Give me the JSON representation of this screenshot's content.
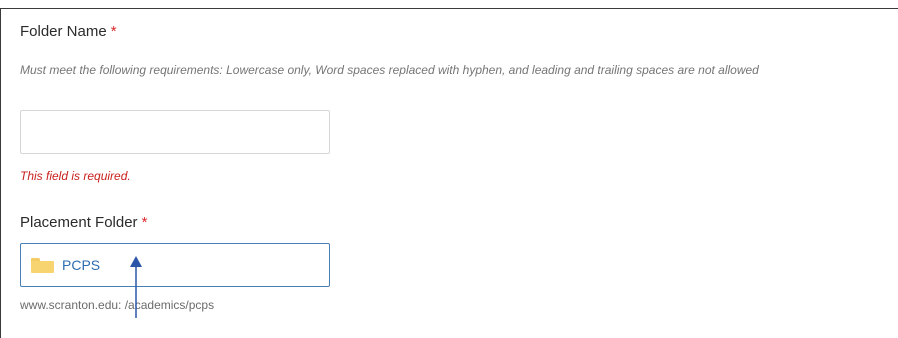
{
  "folder_name": {
    "label": "Folder Name",
    "required_marker": "*",
    "help": "Must meet the following requirements: Lowercase only, Word spaces replaced with hyphen, and leading and trailing spaces are not allowed",
    "value": "",
    "error": "This field is required."
  },
  "placement_folder": {
    "label": "Placement Folder",
    "required_marker": "*",
    "icon": "folder-icon",
    "value": "PCPS",
    "path": "www.scranton.edu: /academics/pcps"
  },
  "colors": {
    "required": "#d9282b",
    "error": "#c9211e",
    "link": "#2d6db0",
    "folder": "#f7d46f",
    "annotation_arrow": "#2b56a8"
  }
}
